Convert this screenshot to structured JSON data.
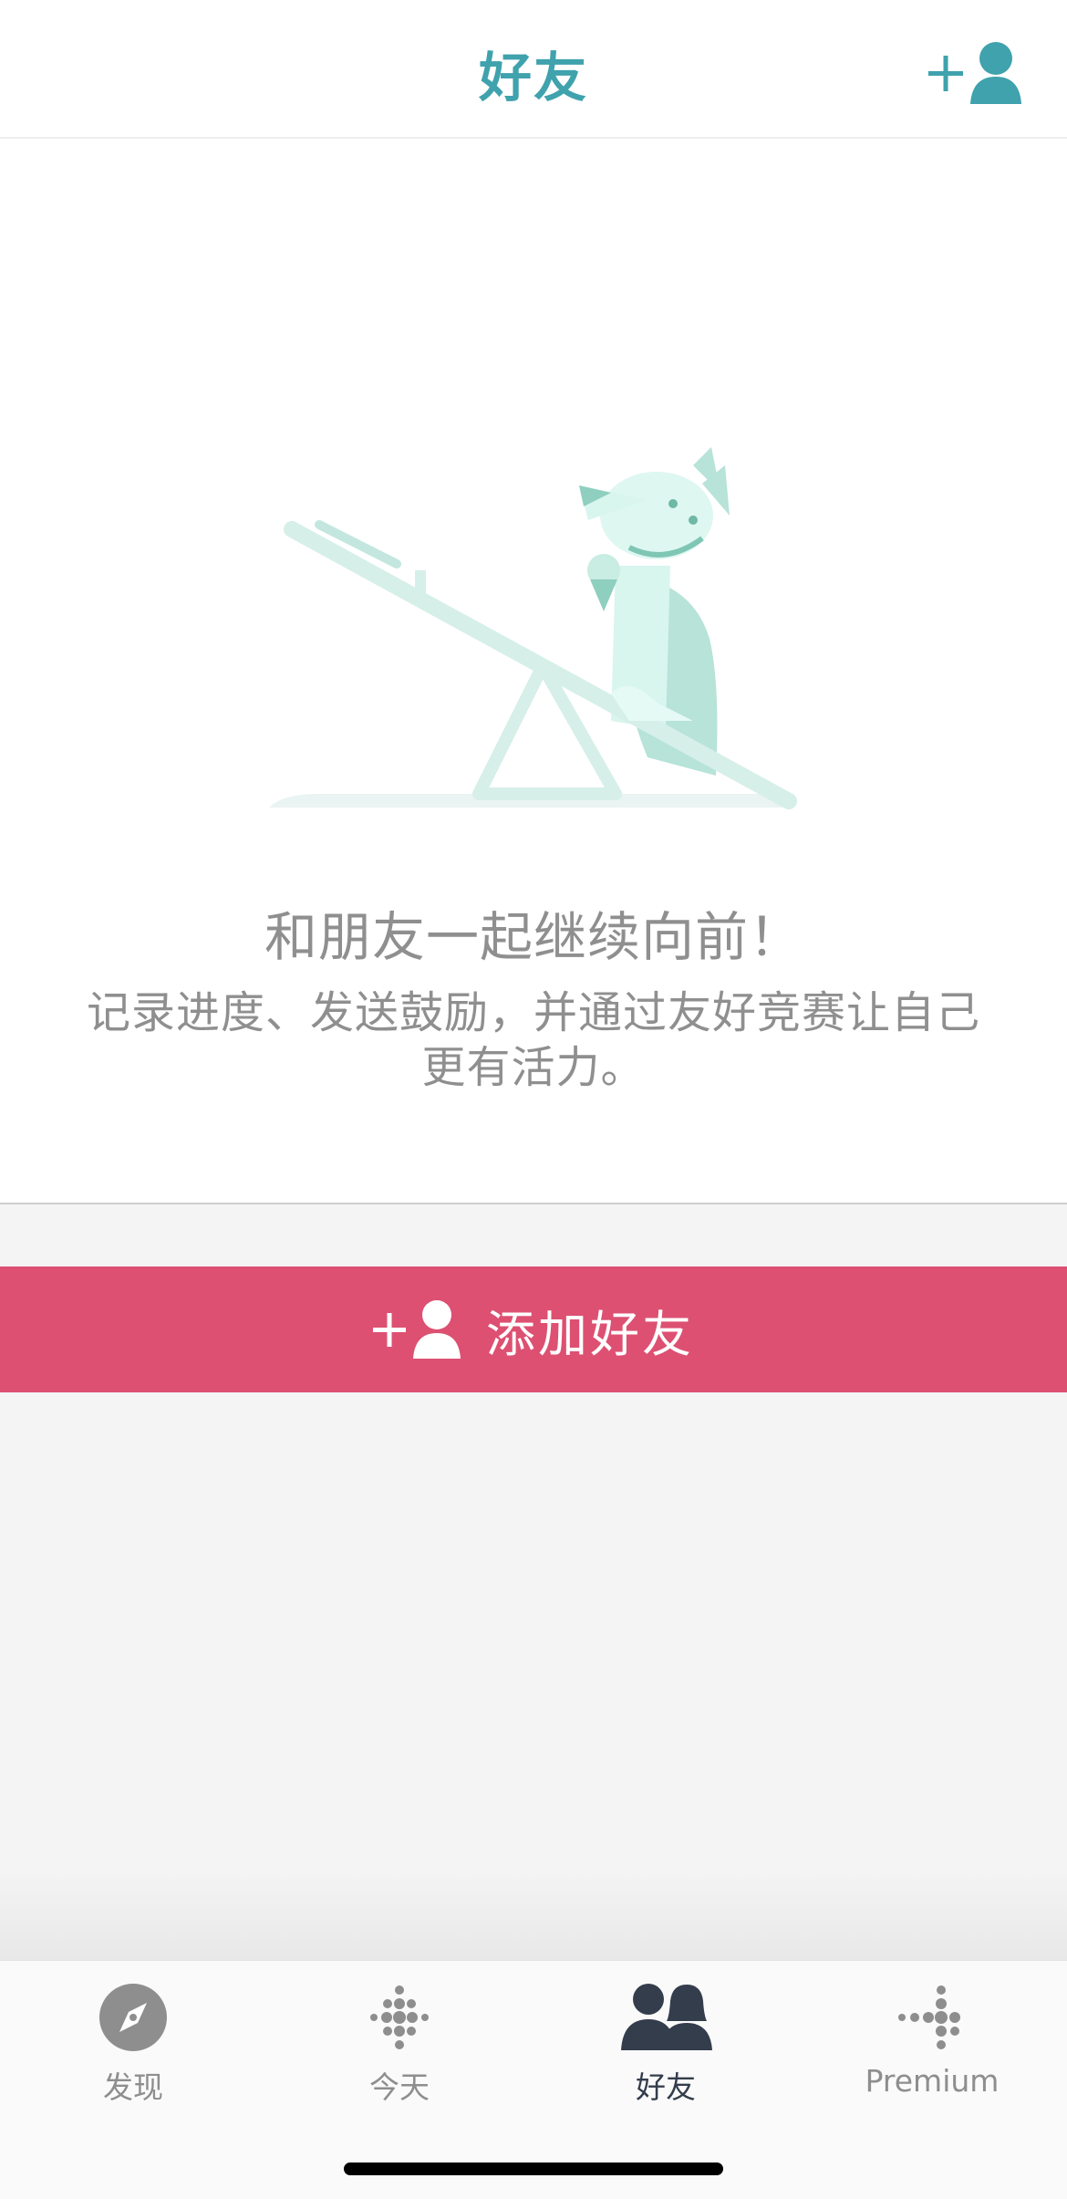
{
  "header": {
    "title": "好友",
    "add_icon": "add-person-icon"
  },
  "empty_state": {
    "headline": "和朋友一起继续向前！",
    "description": "记录进度、发送鼓励，并通过友好竞赛让自己更有活力。",
    "illustration": "dog-on-seesaw-illustration"
  },
  "add_button": {
    "label": "添加好友",
    "icon": "add-person-icon",
    "color": "#dd5072"
  },
  "tabbar": {
    "active": "好友",
    "tabs": [
      {
        "label": "发现",
        "icon": "compass-icon"
      },
      {
        "label": "今天",
        "icon": "fitbit-dots-icon"
      },
      {
        "label": "好友",
        "icon": "friends-icon"
      },
      {
        "label": "Premium",
        "icon": "premium-dots-icon"
      }
    ]
  },
  "colors": {
    "accent": "#3fa2ad",
    "button": "#dd5072",
    "text_gray": "#8f8f8f",
    "tab_active": "#333d4c"
  }
}
